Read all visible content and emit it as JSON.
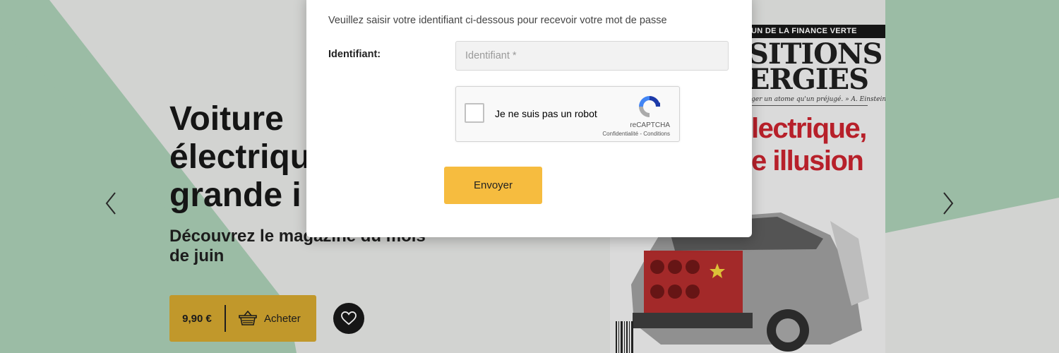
{
  "colors": {
    "accent_yellow": "#f6bc3f",
    "buy_box": "#d3a52c",
    "cover_headline_red": "#c8202b",
    "mint_background": "#a9cdb4"
  },
  "modal": {
    "intro": "Veuillez saisir votre identifiant ci-dessous pour recevoir votre mot de passe",
    "identifier_label": "Identifiant:",
    "identifier_placeholder": "Identifiant *",
    "identifier_value": "",
    "recaptcha": {
      "label": "Je ne suis pas un robot",
      "brand": "reCAPTCHA",
      "links": "Confidentialité - Conditions",
      "checked": false,
      "icon": "recaptcha-logo-icon"
    },
    "submit_label": "Envoyer"
  },
  "hero": {
    "title_lines": [
      "Voiture",
      "électriqu",
      "grande i"
    ],
    "subtitle_lines": [
      "Découvrez le magazine du mois",
      "de juin"
    ],
    "price": "9,90 €",
    "buy_label": "Acheter",
    "buy_icon": "basket-icon",
    "favorite_icon": "heart-icon",
    "prev_icon": "chevron-left-icon",
    "next_icon": "chevron-right-icon"
  },
  "cover": {
    "band_text": "UN DE LA FINANCE VERTE",
    "masthead_line1": "SITIONS",
    "masthead_line2": "ERGIES",
    "quote": "ger un atome qu'un préjugé. » A. Einstein",
    "headline_line1": "lectrique,",
    "headline_line2": "e illusion"
  }
}
